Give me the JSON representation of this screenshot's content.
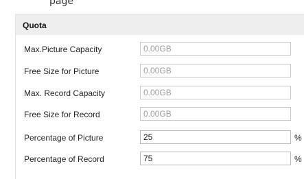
{
  "header_fragment": "  page",
  "quota": {
    "title": "Quota",
    "fields": [
      {
        "label": "Max.Picture Capacity",
        "value": "0.00GB",
        "disabled": true,
        "unit": ""
      },
      {
        "label": "Free Size for Picture",
        "value": "0.00GB",
        "disabled": true,
        "unit": ""
      },
      {
        "label": "Max. Record Capacity",
        "value": "0.00GB",
        "disabled": true,
        "unit": ""
      },
      {
        "label": "Free Size for Record",
        "value": "0.00GB",
        "disabled": true,
        "unit": ""
      },
      {
        "label": "Percentage of Picture",
        "value": "25",
        "disabled": false,
        "unit": "%"
      },
      {
        "label": "Percentage of Record",
        "value": "75",
        "disabled": false,
        "unit": "%"
      }
    ]
  }
}
